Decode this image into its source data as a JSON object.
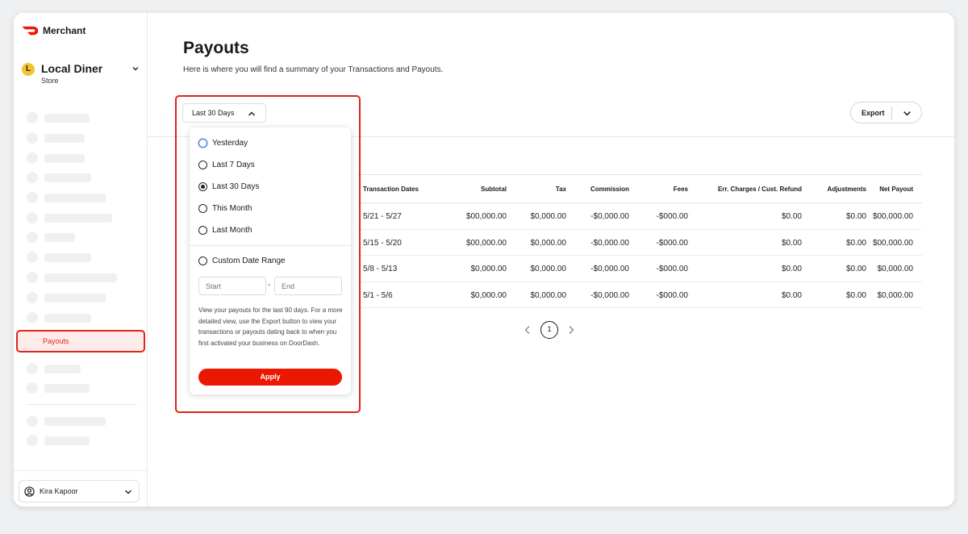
{
  "brand": {
    "name": "Merchant",
    "logo_icon": "doordash-logo-icon",
    "accent": "#eb1700"
  },
  "store": {
    "initial": "L",
    "name": "Local Diner",
    "type": "Store"
  },
  "sidebar": {
    "active_item": "Payouts"
  },
  "user": {
    "name": "Kira Kapoor"
  },
  "page": {
    "title": "Payouts",
    "subtitle": "Here is where you will find a summary of your Transactions and Payouts."
  },
  "filter": {
    "selected": "Last 30 Days"
  },
  "export": {
    "label": "Export"
  },
  "dropdown": {
    "options": [
      "Yesterday",
      "Last 7 Days",
      "Last 30 Days",
      "This Month",
      "Last Month"
    ],
    "custom_label": "Custom Date Range",
    "start_placeholder": "Start",
    "end_placeholder": "End",
    "separator": "-",
    "help_text": "View your payouts for the last 90 days. For a more detailed view, use the Export button to view your transactions or payouts dating back to when you first activated your business on DoorDash.",
    "apply_label": "Apply"
  },
  "table": {
    "headers": [
      "Transaction Dates",
      "Subtotal",
      "Tax",
      "Commission",
      "Fees",
      "Err. Charges / Cust. Refund",
      "Adjustments",
      "Net Payout"
    ],
    "rows": [
      [
        "5/21 - 5/27",
        "$00,000.00",
        "$0,000.00",
        "-$0,000.00",
        "-$000.00",
        "$0.00",
        "$0.00",
        "$00,000.00"
      ],
      [
        "5/15 - 5/20",
        "$00,000.00",
        "$0,000.00",
        "-$0,000.00",
        "-$000.00",
        "$0.00",
        "$0.00",
        "$00,000.00"
      ],
      [
        "5/8 - 5/13",
        "$0,000.00",
        "$0,000.00",
        "-$0,000.00",
        "-$000.00",
        "$0.00",
        "$0.00",
        "$0,000.00"
      ],
      [
        "5/1 - 5/6",
        "$0,000.00",
        "$0,000.00",
        "-$0,000.00",
        "-$000.00",
        "$0.00",
        "$0.00",
        "$0,000.00"
      ]
    ]
  },
  "pagination": {
    "current_page": "1"
  }
}
